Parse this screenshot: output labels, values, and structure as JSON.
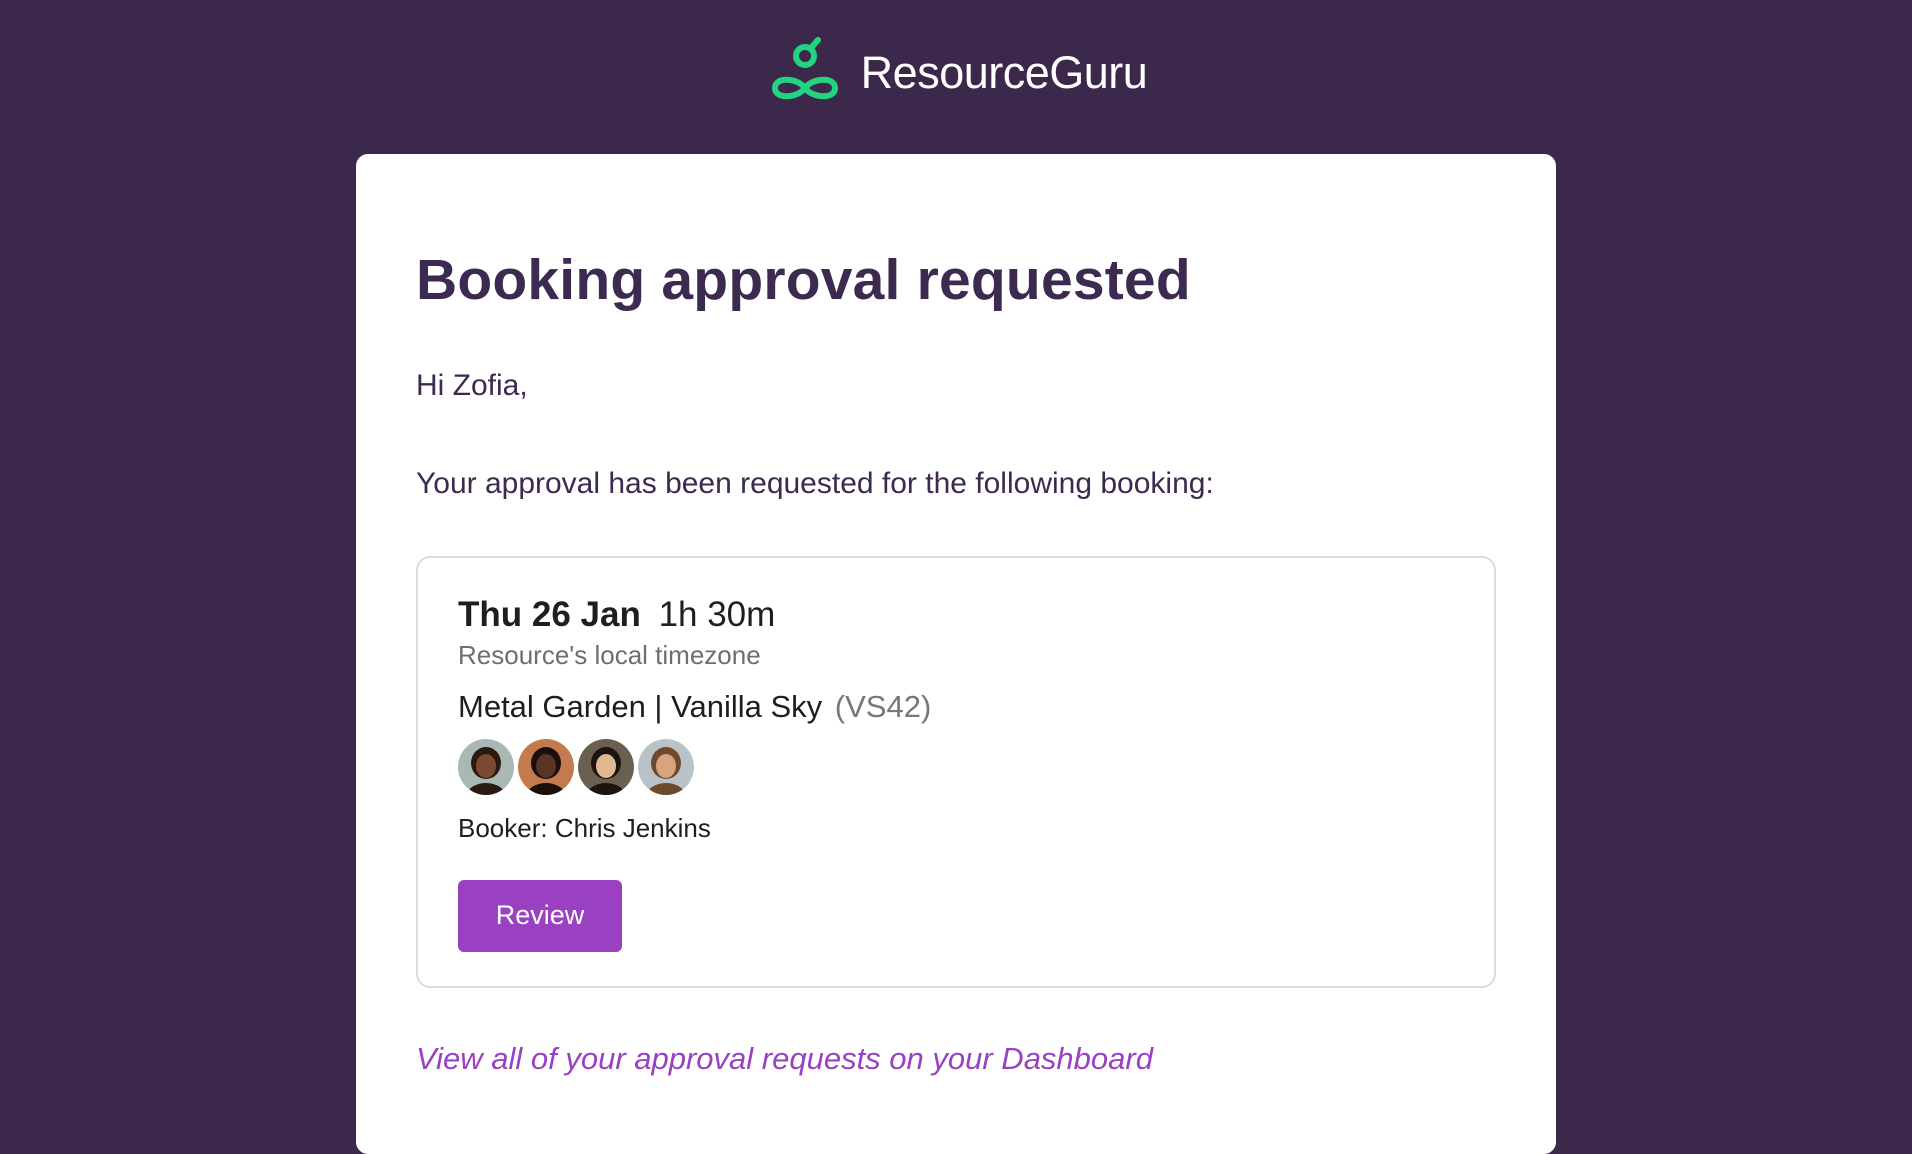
{
  "brand": {
    "name": "ResourceGuru",
    "logo_icon": "resourceguru-infinity-icon",
    "accent_color": "#22d47f",
    "background_color": "#3c284b"
  },
  "email": {
    "title": "Booking approval requested",
    "greeting": "Hi Zofia,",
    "intro": "Your approval has been requested for the following booking:",
    "dashboard_link": "View all of your approval requests on your Dashboard"
  },
  "booking": {
    "date": "Thu 26 Jan",
    "duration": "1h 30m",
    "timezone_note": "Resource's local timezone",
    "resource": "Metal Garden | Vanilla Sky",
    "resource_code": "(VS42)",
    "avatars": [
      {
        "name": "avatar-1",
        "bg": "#a9b8b4",
        "skin": "#7a4a32",
        "hair": "#2a1a12"
      },
      {
        "name": "avatar-2",
        "bg": "#c27a4e",
        "skin": "#5a3324",
        "hair": "#1a0f0a"
      },
      {
        "name": "avatar-3",
        "bg": "#6b5f52",
        "skin": "#e0b894",
        "hair": "#1c1410"
      },
      {
        "name": "avatar-4",
        "bg": "#b9c2c7",
        "skin": "#d8a47e",
        "hair": "#6e4a2c"
      }
    ],
    "booker": "Booker: Chris Jenkins",
    "review_label": "Review",
    "button_color": "#9a40c3"
  }
}
